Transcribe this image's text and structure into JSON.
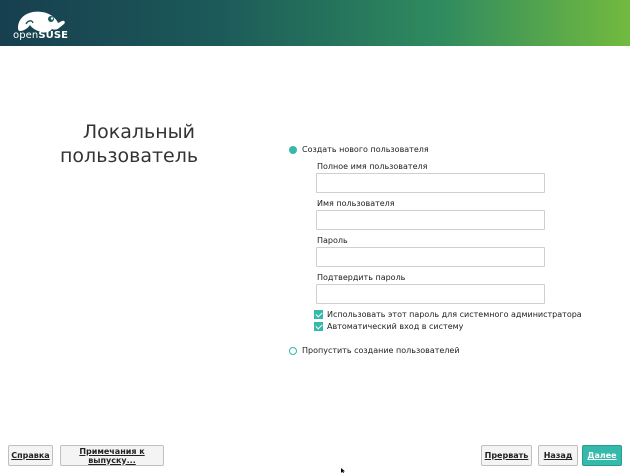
{
  "brand": {
    "open": "open",
    "suse": "SUSE",
    "accent": "#35b9ab",
    "logo_icon": "chameleon-icon"
  },
  "page": {
    "title_line1": "Локальный",
    "title_line2": "пользователь"
  },
  "form": {
    "create_user_label": "Создать нового пользователя",
    "create_user_selected": true,
    "full_name": {
      "label": "Полное имя пользователя",
      "value": ""
    },
    "username": {
      "label": "Имя пользователя",
      "value": ""
    },
    "password": {
      "label": "Пароль",
      "value": ""
    },
    "confirm_password": {
      "label": "Подтвердить пароль",
      "value": ""
    },
    "use_for_admin": {
      "label": "Использовать этот пароль для системного администратора",
      "checked": true
    },
    "autologin": {
      "label": "Автоматический вход в систему",
      "checked": true
    },
    "skip_user_label": "Пропустить создание пользователей",
    "skip_user_selected": false
  },
  "footer": {
    "help": "Справка",
    "release_notes": "Примечания к выпуску...",
    "abort": "Прервать",
    "back": "Назад",
    "next": "Далее"
  }
}
